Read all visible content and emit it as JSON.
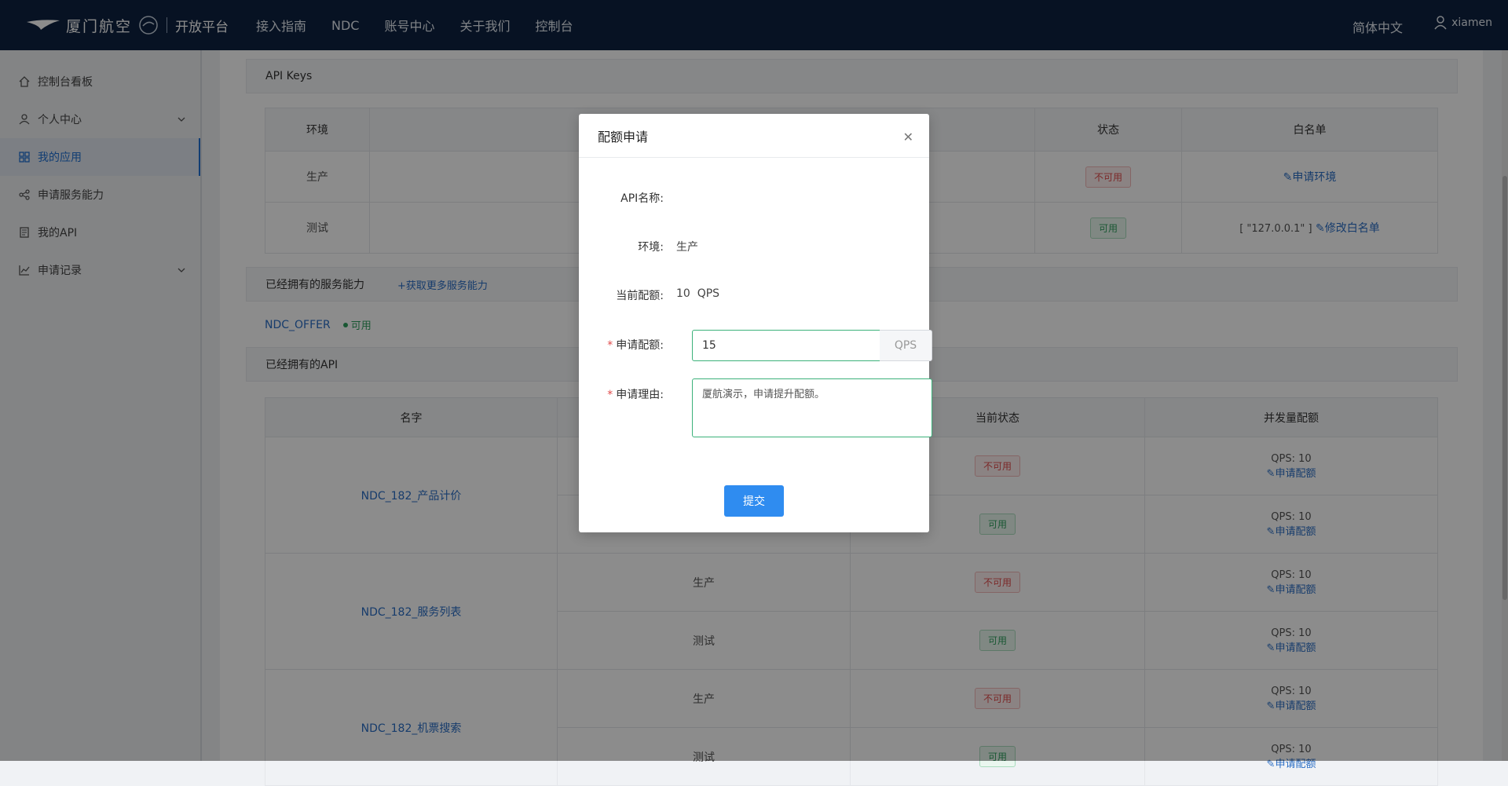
{
  "header": {
    "logo_text": "厦门航空",
    "platform": "开放平台",
    "nav": [
      "接入指南",
      "NDC",
      "账号中心",
      "关于我们",
      "控制台"
    ],
    "language": "简体中文",
    "username": "xiamen"
  },
  "sidebar": {
    "items": [
      {
        "label": "控制台看板",
        "icon": "home-icon"
      },
      {
        "label": "个人中心",
        "icon": "user-icon"
      },
      {
        "label": "我的应用",
        "icon": "grid-icon"
      },
      {
        "label": "申请服务能力",
        "icon": "share-icon"
      },
      {
        "label": "我的API",
        "icon": "book-icon"
      },
      {
        "label": "申请记录",
        "icon": "chart-icon"
      }
    ]
  },
  "api_keys": {
    "title": "API Keys",
    "headers": [
      "环境",
      "",
      "状态",
      "白名单"
    ],
    "rows": [
      {
        "env": "生产",
        "status": "不可用",
        "whitelist_text": "",
        "whitelist_link": "申请环境"
      },
      {
        "env": "测试",
        "status": "可用",
        "whitelist_text": "[ \"127.0.0.1\" ]",
        "whitelist_link": "修改白名单"
      }
    ]
  },
  "services": {
    "title": "已经拥有的服务能力",
    "more_link": "+获取更多服务能力",
    "item": "NDC_OFFER",
    "item_status": "可用"
  },
  "apis": {
    "title": "已经拥有的API",
    "headers": [
      "名字",
      "",
      "当前状态",
      "并发量配额"
    ],
    "groups": [
      {
        "name": "NDC_182_产品计价",
        "rows": [
          {
            "env": "",
            "status": "不可用",
            "qps": "QPS: 10",
            "link": "申请配额"
          },
          {
            "env": "",
            "status": "可用",
            "qps": "QPS: 10",
            "link": "申请配额"
          }
        ]
      },
      {
        "name": "NDC_182_服务列表",
        "rows": [
          {
            "env": "生产",
            "status": "不可用",
            "qps": "QPS: 10",
            "link": "申请配额"
          },
          {
            "env": "测试",
            "status": "可用",
            "qps": "QPS: 10",
            "link": "申请配额"
          }
        ]
      },
      {
        "name": "NDC_182_机票搜索",
        "rows": [
          {
            "env": "生产",
            "status": "不可用",
            "qps": "QPS: 10",
            "link": "申请配额"
          },
          {
            "env": "测试",
            "status": "可用",
            "qps": "QPS: 10",
            "link": "申请配额"
          }
        ]
      }
    ]
  },
  "modal": {
    "title": "配额申请",
    "api_name_label": "API名称:",
    "api_name_value": "",
    "env_label": "环境:",
    "env_value": "生产",
    "current_label": "当前配额:",
    "current_value": "10  QPS",
    "request_label": "申请配额:",
    "request_value": "15",
    "request_unit": "QPS",
    "reason_label": "申请理由:",
    "reason_value": "厦航演示，申请提升配额。",
    "submit_label": "提交"
  }
}
